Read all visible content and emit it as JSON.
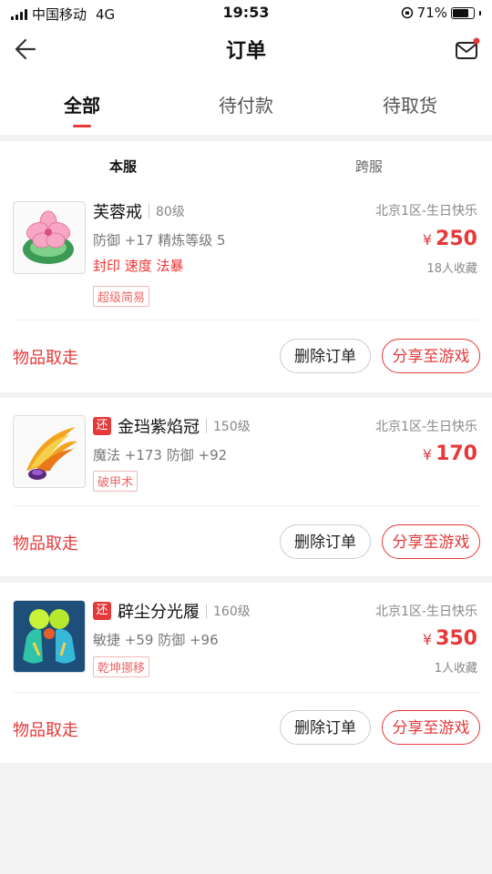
{
  "status_bar": {
    "carrier": "中国移动",
    "network": "4G",
    "time": "19:53",
    "battery": "71%"
  },
  "nav": {
    "title": "订单"
  },
  "tabs": [
    {
      "label": "全部",
      "active": true
    },
    {
      "label": "待付款",
      "active": false
    },
    {
      "label": "待取货",
      "active": false
    }
  ],
  "server_tabs": [
    {
      "label": "本服",
      "active": true
    },
    {
      "label": "跨服",
      "active": false
    }
  ],
  "orders": [
    {
      "name": "芙蓉戒",
      "level": "80级",
      "stats": "防御 +17 精炼等级 5",
      "skills": "封印 速度 法暴",
      "tag": "超级简易",
      "server": "北京1区-生日快乐",
      "currency": "¥",
      "price": "250",
      "favorites": "18人收藏",
      "retrieve_label": "物品取走",
      "delete_label": "删除订单",
      "share_label": "分享至游戏"
    },
    {
      "badge": "还",
      "name": "金珰紫焰冠",
      "level": "150级",
      "stats": "魔法 +173 防御 +92",
      "tag": "破甲术",
      "server": "北京1区-生日快乐",
      "currency": "¥",
      "price": "170",
      "retrieve_label": "物品取走",
      "delete_label": "删除订单",
      "share_label": "分享至游戏"
    },
    {
      "badge": "还",
      "name": "辟尘分光履",
      "level": "160级",
      "stats": "敏捷 +59 防御 +96",
      "tag": "乾坤挪移",
      "server": "北京1区-生日快乐",
      "currency": "¥",
      "price": "350",
      "favorites": "1人收藏",
      "retrieve_label": "物品取走",
      "delete_label": "删除订单",
      "share_label": "分享至游戏"
    }
  ],
  "icons": {
    "back": "back-arrow-icon",
    "mail": "mail-icon",
    "notification_dot_color": "#e5393a"
  },
  "colors": {
    "accent": "#e5393a"
  }
}
